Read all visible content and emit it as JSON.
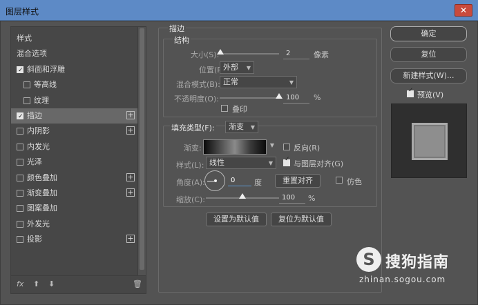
{
  "window": {
    "title": "图层样式",
    "close": "✕"
  },
  "left_panel": {
    "items": [
      {
        "label": "样式",
        "checkbox": false,
        "checked": false,
        "plus": false,
        "indent": 0
      },
      {
        "label": "混合选项",
        "checkbox": false,
        "checked": false,
        "plus": false,
        "indent": 0
      },
      {
        "label": "斜面和浮雕",
        "checkbox": true,
        "checked": true,
        "plus": false,
        "indent": 0
      },
      {
        "label": "等高线",
        "checkbox": true,
        "checked": false,
        "plus": false,
        "indent": 1
      },
      {
        "label": "纹理",
        "checkbox": true,
        "checked": false,
        "plus": false,
        "indent": 1
      },
      {
        "label": "描边",
        "checkbox": true,
        "checked": true,
        "plus": true,
        "indent": 0,
        "selected": true
      },
      {
        "label": "内阴影",
        "checkbox": true,
        "checked": false,
        "plus": true,
        "indent": 0
      },
      {
        "label": "内发光",
        "checkbox": true,
        "checked": false,
        "plus": false,
        "indent": 0
      },
      {
        "label": "光泽",
        "checkbox": true,
        "checked": false,
        "plus": false,
        "indent": 0
      },
      {
        "label": "颜色叠加",
        "checkbox": true,
        "checked": false,
        "plus": true,
        "indent": 0
      },
      {
        "label": "渐变叠加",
        "checkbox": true,
        "checked": false,
        "plus": true,
        "indent": 0
      },
      {
        "label": "图案叠加",
        "checkbox": true,
        "checked": false,
        "plus": false,
        "indent": 0
      },
      {
        "label": "外发光",
        "checkbox": true,
        "checked": false,
        "plus": false,
        "indent": 0
      },
      {
        "label": "投影",
        "checkbox": true,
        "checked": false,
        "plus": true,
        "indent": 0
      }
    ],
    "footer": {
      "fx": "fx",
      "up": "⬆",
      "down": "⬇",
      "trash": "🗑"
    }
  },
  "stroke": {
    "title": "描边",
    "structure": {
      "title": "结构",
      "size_label": "大小(S):",
      "size_value": "2",
      "size_unit": "像素",
      "size_fraction": 0.01,
      "position_label": "位置(P):",
      "position_value": "外部",
      "blend_label": "混合模式(B):",
      "blend_value": "正常",
      "opacity_label": "不透明度(O):",
      "opacity_value": "100",
      "opacity_unit": "%",
      "opacity_fraction": 1.0,
      "overprint_label": "叠印"
    },
    "fill": {
      "type_label": "填充类型(F):",
      "type_value": "渐变",
      "gradient_label": "渐变:",
      "reverse_label": "反向(R)",
      "style_label": "样式(L):",
      "style_value": "线性",
      "align_label": "与图层对齐(G)",
      "angle_label": "角度(A):",
      "angle_value": "0",
      "angle_unit": "度",
      "reset_align": "重置对齐",
      "dither_label": "仿色",
      "scale_label": "缩放(C):",
      "scale_value": "100",
      "scale_unit": "%",
      "scale_fraction": 0.5
    },
    "set_default": "设置为默认值",
    "reset_default": "复位为默认值"
  },
  "right": {
    "ok": "确定",
    "reset": "复位",
    "new_style": "新建样式(W)...",
    "preview_label": "预览(V)"
  },
  "watermark": {
    "symbol": "S",
    "brand": "搜狗指南",
    "url": "zhinan.sogou.com"
  }
}
